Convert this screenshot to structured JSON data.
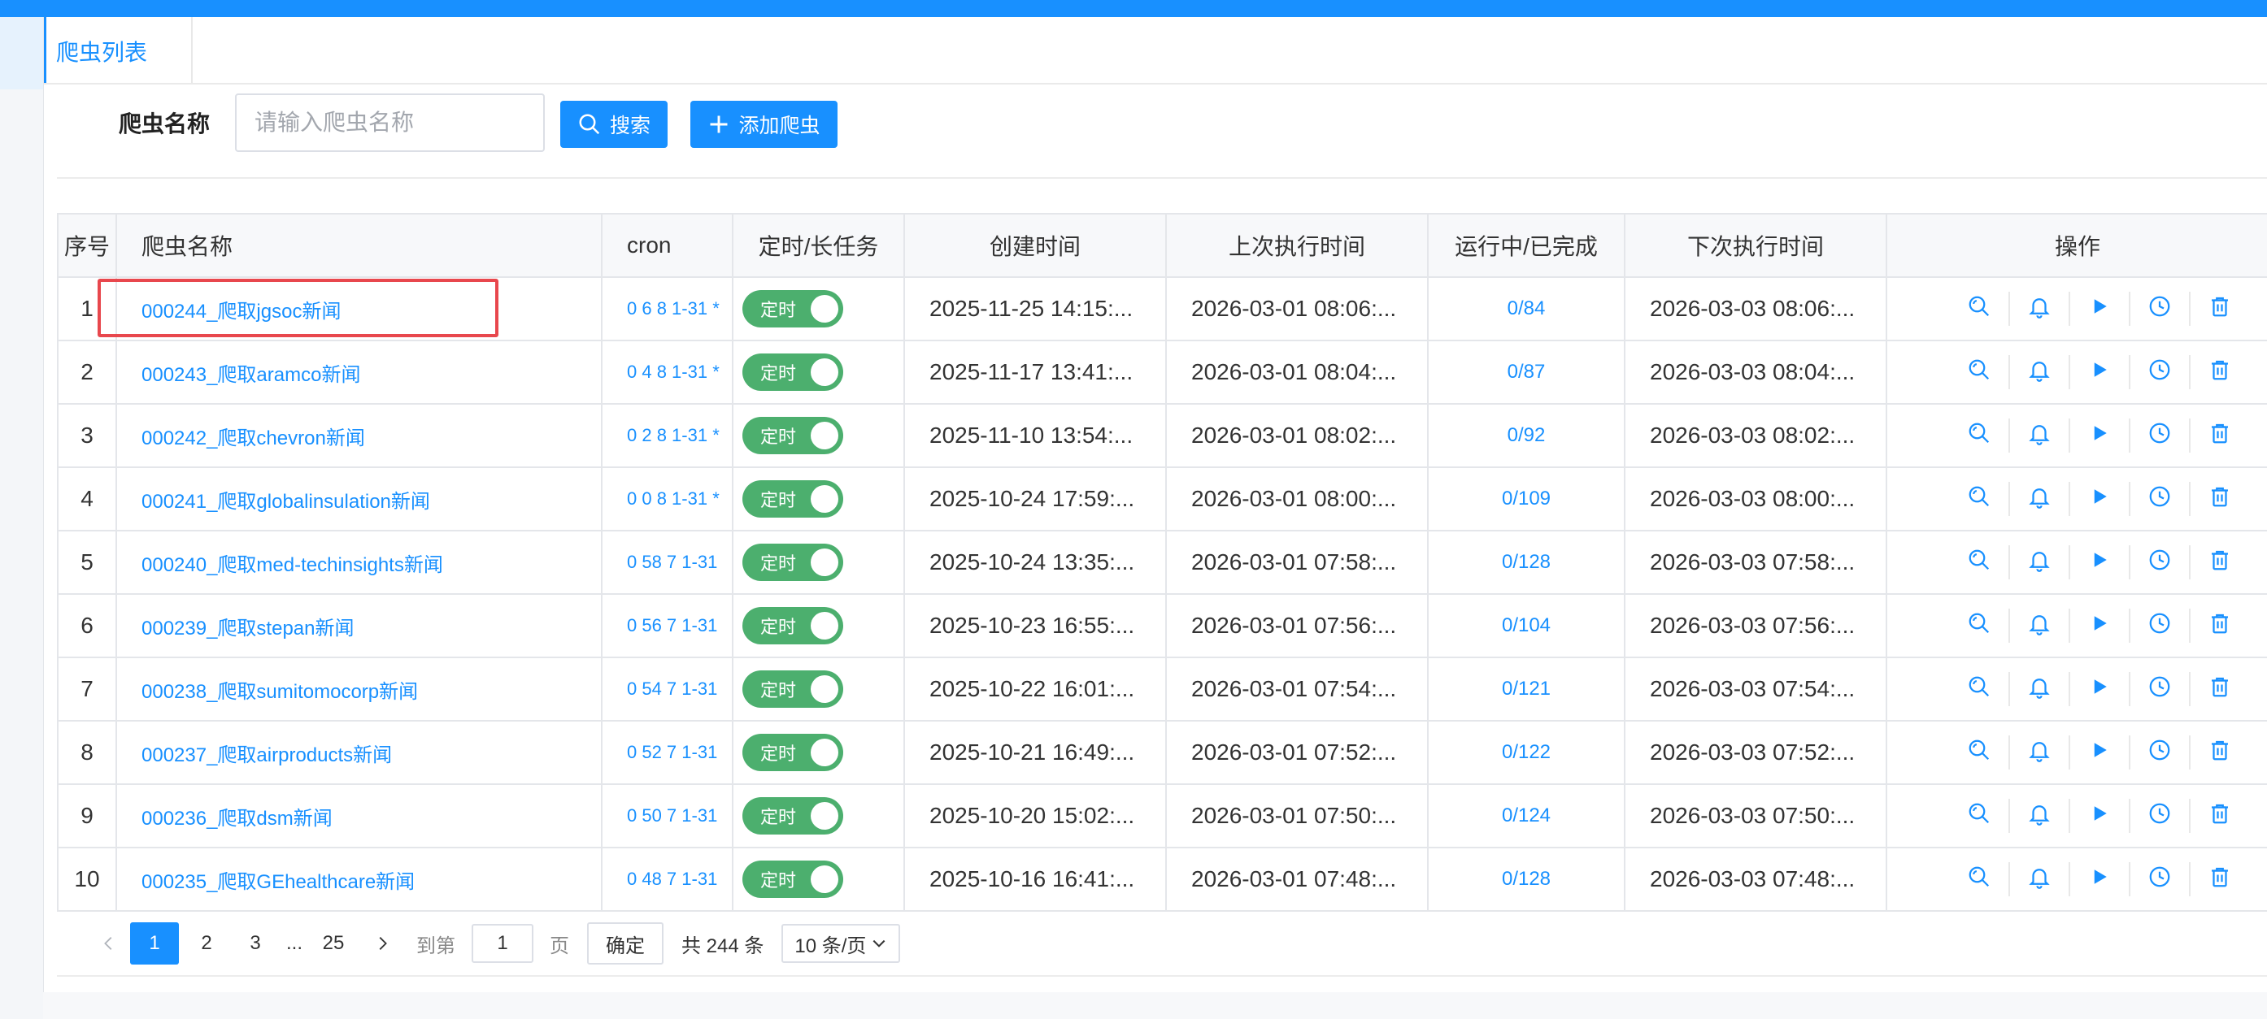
{
  "tabs": [
    {
      "label": "爬虫列表"
    }
  ],
  "search": {
    "label": "爬虫名称",
    "placeholder": "请输入爬虫名称",
    "value": "",
    "search_button": "搜索",
    "add_button": "添加爬虫"
  },
  "table": {
    "columns": [
      "序号",
      "爬虫名称",
      "cron",
      "定时/长任务",
      "创建时间",
      "上次执行时间",
      "运行中/已完成",
      "下次执行时间",
      "操作"
    ],
    "toggle_label": "定时",
    "rows": [
      {
        "idx": "1",
        "name": "000244_爬取jgsoc新闻",
        "cron": "0 6 8 1-31 *",
        "created": "2025-11-25 14:15:...",
        "last": "2026-03-01 08:06:...",
        "run": "0/84",
        "next": "2026-03-03 08:06:..."
      },
      {
        "idx": "2",
        "name": "000243_爬取aramco新闻",
        "cron": "0 4 8 1-31 *",
        "created": "2025-11-17 13:41:...",
        "last": "2026-03-01 08:04:...",
        "run": "0/87",
        "next": "2026-03-03 08:04:..."
      },
      {
        "idx": "3",
        "name": "000242_爬取chevron新闻",
        "cron": "0 2 8 1-31 *",
        "created": "2025-11-10 13:54:...",
        "last": "2026-03-01 08:02:...",
        "run": "0/92",
        "next": "2026-03-03 08:02:..."
      },
      {
        "idx": "4",
        "name": "000241_爬取globalinsulation新闻",
        "cron": "0 0 8 1-31 *",
        "created": "2025-10-24 17:59:...",
        "last": "2026-03-01 08:00:...",
        "run": "0/109",
        "next": "2026-03-03 08:00:..."
      },
      {
        "idx": "5",
        "name": "000240_爬取med-techinsights新闻",
        "cron": "0 58 7 1-31",
        "created": "2025-10-24 13:35:...",
        "last": "2026-03-01 07:58:...",
        "run": "0/128",
        "next": "2026-03-03 07:58:..."
      },
      {
        "idx": "6",
        "name": "000239_爬取stepan新闻",
        "cron": "0 56 7 1-31",
        "created": "2025-10-23 16:55:...",
        "last": "2026-03-01 07:56:...",
        "run": "0/104",
        "next": "2026-03-03 07:56:..."
      },
      {
        "idx": "7",
        "name": "000238_爬取sumitomocorp新闻",
        "cron": "0 54 7 1-31",
        "created": "2025-10-22 16:01:...",
        "last": "2026-03-01 07:54:...",
        "run": "0/121",
        "next": "2026-03-03 07:54:..."
      },
      {
        "idx": "8",
        "name": "000237_爬取airproducts新闻",
        "cron": "0 52 7 1-31",
        "created": "2025-10-21 16:49:...",
        "last": "2026-03-01 07:52:...",
        "run": "0/122",
        "next": "2026-03-03 07:52:..."
      },
      {
        "idx": "9",
        "name": "000236_爬取dsm新闻",
        "cron": "0 50 7 1-31",
        "created": "2025-10-20 15:02:...",
        "last": "2026-03-01 07:50:...",
        "run": "0/124",
        "next": "2026-03-03 07:50:..."
      },
      {
        "idx": "10",
        "name": "000235_爬取GEhealthcare新闻",
        "cron": "0 48 7 1-31",
        "created": "2025-10-16 16:41:...",
        "last": "2026-03-01 07:48:...",
        "run": "0/128",
        "next": "2026-03-03 07:48:..."
      }
    ],
    "actions": [
      "search-icon",
      "bell-icon",
      "play-icon",
      "clock-icon",
      "trash-icon"
    ]
  },
  "pagination": {
    "pages": [
      "1",
      "2",
      "3",
      "...",
      "25"
    ],
    "current": "1",
    "goto_label": "到第",
    "goto_value": "1",
    "page_word": "页",
    "confirm": "确定",
    "total": "共 244 条",
    "page_size": "10 条/页"
  },
  "colors": {
    "primary": "#1890ff",
    "toggle_on": "#4caf6e",
    "highlight": "#e8474d"
  }
}
